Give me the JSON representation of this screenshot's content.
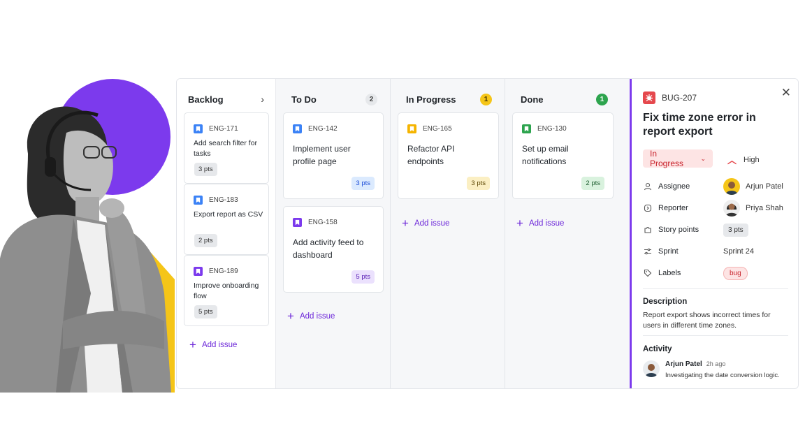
{
  "board": {
    "columns": [
      {
        "title": "Backlog",
        "count": ""
      },
      {
        "title": "To Do",
        "count": "2"
      },
      {
        "title": "In Progress",
        "count": "1"
      },
      {
        "title": "Done",
        "count": "1"
      }
    ],
    "backlog": [
      {
        "key": "ENG-171",
        "title": "Add search filter for tasks",
        "points": "3 pts",
        "type_color": "#3b82f6"
      },
      {
        "key": "ENG-183",
        "title": "Export report as CSV",
        "points": "2 pts",
        "type_color": "#3b82f6"
      },
      {
        "key": "ENG-189",
        "title": "Improve onboarding flow",
        "points": "5 pts",
        "type_color": "#7c3aed"
      }
    ],
    "todo": [
      {
        "key": "ENG-142",
        "title": "Implement user profile page",
        "points": "3 pts",
        "type_color": "#3b82f6"
      },
      {
        "key": "ENG-158",
        "title": "Add activity feed to dashboard",
        "points": "5 pts",
        "type_color": "#7c3aed"
      }
    ],
    "in_progress": [
      {
        "key": "ENG-165",
        "title": "Refactor API endpoints",
        "points": "3 pts",
        "type_color": "#f5b400"
      }
    ],
    "done": [
      {
        "key": "ENG-130",
        "title": "Set up email notifications",
        "points": "2 pts",
        "type_color": "#2da44e"
      }
    ],
    "add_issue_label": "Add issue"
  },
  "detail": {
    "key": "BUG-207",
    "title": "Fix time zone error in report export",
    "status": "In Progress",
    "priority": "High",
    "fields": {
      "assignee_label": "Assignee",
      "assignee": "Arjun Patel",
      "reporter_label": "Reporter",
      "reporter": "Priya Shah",
      "story_points_label": "Story points",
      "story_points": "3 pts",
      "sprint_label": "Sprint",
      "sprint": "Sprint 24",
      "labels_label": "Labels",
      "label": "bug"
    },
    "description_title": "Description",
    "description": "Report export shows incorrect times for users in different time zones.",
    "activity_title": "Activity",
    "activity": {
      "author": "Arjun Patel",
      "time": "2h ago",
      "text": "Investigating the date conversion logic."
    }
  },
  "colors": {
    "accent": "#7c3aed",
    "hero_circle": "#7c3aed",
    "hero_shape": "#f5c518",
    "status_red": "#e5484d"
  }
}
